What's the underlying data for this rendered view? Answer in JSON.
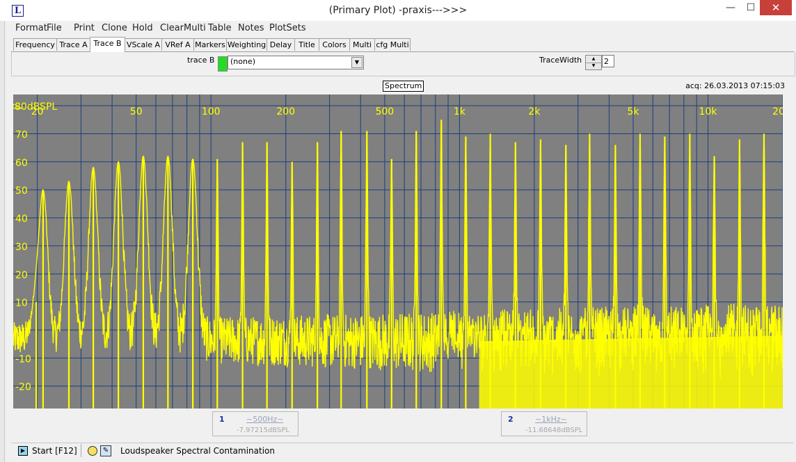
{
  "window": {
    "title": "(Primary Plot) -praxis--->>>",
    "app_icon": "L",
    "buttons": {
      "minimize": "—",
      "maximize": "☐",
      "close": "✕"
    }
  },
  "menu": [
    "Format",
    "File",
    "Print",
    "Clone",
    "Hold",
    "ClearMulti",
    "Table",
    "Notes",
    "PlotSets"
  ],
  "tabs": {
    "items": [
      "Frequency",
      "Trace A",
      "Trace B",
      "VScale A",
      "VRef A",
      "Markers",
      "Weighting",
      "Delay",
      "Title",
      "Colors",
      "Multi",
      "cfg Multi"
    ],
    "active": "Trace B"
  },
  "controls": {
    "traceb_label": "trace B",
    "traceb_color": "#22dd22",
    "traceb_selected": "(none)",
    "tracewidth_label": "TraceWidth",
    "tracewidth_value": "2"
  },
  "plot": {
    "header": "Spectrum",
    "acq": "acq: 26.03.2013 07:15:03",
    "bg_color": "#808080",
    "grid_color": "#1a3f7a",
    "trace_color": "#ffff00",
    "y_unit_label": "80dBSPL",
    "x_ticks": [
      {
        "f": 20,
        "label": "20"
      },
      {
        "f": 50,
        "label": "50"
      },
      {
        "f": 100,
        "label": "100"
      },
      {
        "f": 200,
        "label": "200"
      },
      {
        "f": 500,
        "label": "500"
      },
      {
        "f": 1000,
        "label": "1k"
      },
      {
        "f": 2000,
        "label": "2k"
      },
      {
        "f": 5000,
        "label": "5k"
      },
      {
        "f": 10000,
        "label": "10k"
      },
      {
        "f": 20000,
        "label": "20"
      }
    ],
    "y_ticks": [
      70,
      60,
      50,
      40,
      30,
      20,
      10,
      0,
      -10,
      -20
    ]
  },
  "chart_data": {
    "type": "line",
    "title": "Spectrum",
    "xlabel": "",
    "ylabel": "dBSPL",
    "x_scale": "log",
    "xlim": [
      16,
      20000
    ],
    "ylim": [
      -28,
      84
    ],
    "noise_floor_db": -2,
    "harmonic_peaks": [
      {
        "f": 19.8,
        "db": 10
      },
      {
        "f": 21.1,
        "db": 50
      },
      {
        "f": 26.8,
        "db": 53
      },
      {
        "f": 33.6,
        "db": 58
      },
      {
        "f": 42.4,
        "db": 60
      },
      {
        "f": 53.4,
        "db": 62
      },
      {
        "f": 67.1,
        "db": 62
      },
      {
        "f": 84.5,
        "db": 61
      },
      {
        "f": 106,
        "db": 61
      },
      {
        "f": 134,
        "db": 67
      },
      {
        "f": 168,
        "db": 67
      },
      {
        "f": 212,
        "db": 60
      },
      {
        "f": 268,
        "db": 67
      },
      {
        "f": 334,
        "db": 71
      },
      {
        "f": 424,
        "db": 71
      },
      {
        "f": 533,
        "db": 61
      },
      {
        "f": 670,
        "db": 71
      },
      {
        "f": 845,
        "db": 75
      },
      {
        "f": 1060,
        "db": 69
      },
      {
        "f": 1330,
        "db": 70
      },
      {
        "f": 1680,
        "db": 67
      },
      {
        "f": 2120,
        "db": 68
      },
      {
        "f": 2680,
        "db": 66
      },
      {
        "f": 3340,
        "db": 70
      },
      {
        "f": 4240,
        "db": 66
      },
      {
        "f": 5330,
        "db": 70
      },
      {
        "f": 6700,
        "db": 69
      },
      {
        "f": 8450,
        "db": 70
      },
      {
        "f": 10600,
        "db": 62
      },
      {
        "f": 13400,
        "db": 68
      },
      {
        "f": 16800,
        "db": 70
      }
    ]
  },
  "markers": [
    {
      "num": "1",
      "freq": "~500Hz~",
      "value": "-7.97215dBSPL"
    },
    {
      "num": "2",
      "freq": "~1kHz~",
      "value": "-11.68648dBSPL"
    }
  ],
  "status": {
    "start": "Start [F12]",
    "text": "Loudspeaker Spectral Contamination"
  }
}
